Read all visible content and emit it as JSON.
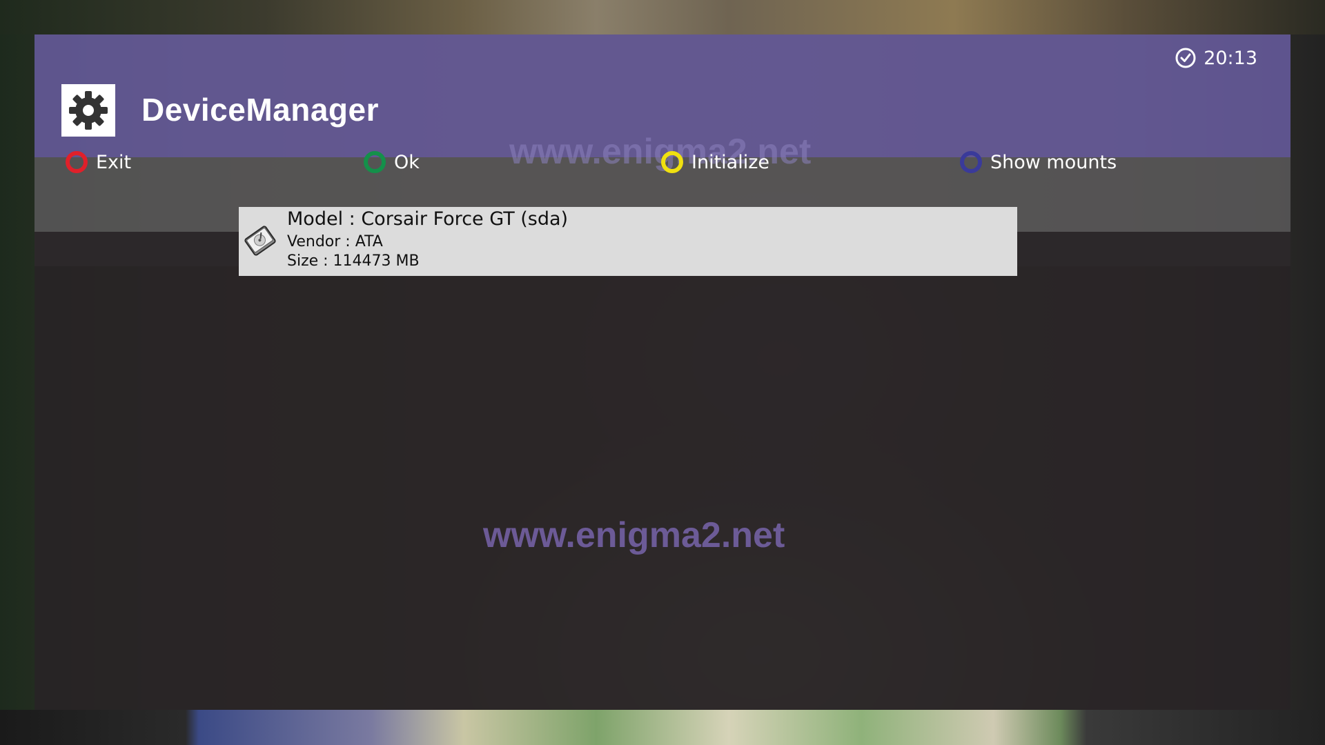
{
  "header": {
    "title": "DeviceManager",
    "clock": "20:13",
    "icon": "gear-icon",
    "background_color": "#685ca0"
  },
  "buttons": [
    {
      "key": "red",
      "label": "Exit",
      "color": "#e0202a"
    },
    {
      "key": "green",
      "label": "Ok",
      "color": "#14904a"
    },
    {
      "key": "yellow",
      "label": "Initialize",
      "color": "#f0e010"
    },
    {
      "key": "blue",
      "label": "Show mounts",
      "color": "#3a3a9a"
    }
  ],
  "devices": [
    {
      "model": "Model : Corsair Force GT (sda)",
      "vendor": "Vendor : ATA",
      "size": "Size : 114473 MB",
      "icon": "hard-disk-icon",
      "selected": true
    }
  ],
  "watermarks": {
    "header": "www.enigma2.net",
    "center": "www.enigma2.net"
  }
}
